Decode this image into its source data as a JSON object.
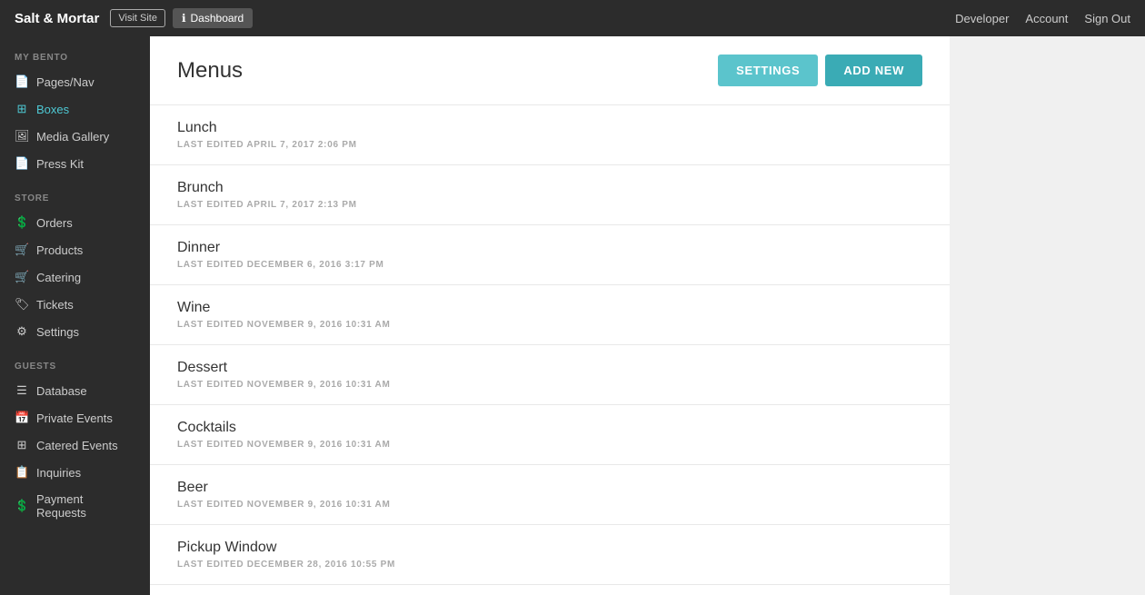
{
  "brand": "Salt & Mortar",
  "topnav": {
    "visit_site": "Visit Site",
    "dashboard": "Dashboard",
    "right_links": [
      "Developer",
      "Account",
      "Sign Out"
    ]
  },
  "sidebar": {
    "sections": [
      {
        "label": "MY BENTO",
        "items": [
          {
            "id": "pages-nav",
            "icon": "📄",
            "label": "Pages/Nav",
            "active": false
          },
          {
            "id": "boxes",
            "icon": "⊞",
            "label": "Boxes",
            "active": true
          },
          {
            "id": "media-gallery",
            "icon": "🖼",
            "label": "Media Gallery",
            "active": false
          },
          {
            "id": "press-kit",
            "icon": "📄",
            "label": "Press Kit",
            "active": false
          }
        ]
      },
      {
        "label": "STORE",
        "items": [
          {
            "id": "orders",
            "icon": "$",
            "label": "Orders",
            "active": false
          },
          {
            "id": "products",
            "icon": "🛒",
            "label": "Products",
            "active": false
          },
          {
            "id": "catering",
            "icon": "🛒",
            "label": "Catering",
            "active": false
          },
          {
            "id": "tickets",
            "icon": "🏷",
            "label": "Tickets",
            "active": false
          },
          {
            "id": "settings",
            "icon": "⚙",
            "label": "Settings",
            "active": false
          }
        ]
      },
      {
        "label": "GUESTS",
        "items": [
          {
            "id": "database",
            "icon": "☰",
            "label": "Database",
            "active": false
          },
          {
            "id": "private-events",
            "icon": "📅",
            "label": "Private Events",
            "active": false
          },
          {
            "id": "catered-events",
            "icon": "⊞",
            "label": "Catered Events",
            "active": false
          },
          {
            "id": "inquiries",
            "icon": "📋",
            "label": "Inquiries",
            "active": false
          },
          {
            "id": "payment-requests",
            "icon": "$",
            "label": "Payment Requests",
            "active": false
          }
        ]
      }
    ]
  },
  "content": {
    "title": "Menus",
    "settings_btn": "SETTINGS",
    "add_new_btn": "ADD NEW",
    "menus": [
      {
        "name": "Lunch",
        "last_edited": "LAST EDITED APRIL 7, 2017 2:06 PM"
      },
      {
        "name": "Brunch",
        "last_edited": "LAST EDITED APRIL 7, 2017 2:13 PM"
      },
      {
        "name": "Dinner",
        "last_edited": "LAST EDITED DECEMBER 6, 2016 3:17 PM"
      },
      {
        "name": "Wine",
        "last_edited": "LAST EDITED NOVEMBER 9, 2016 10:31 AM"
      },
      {
        "name": "Dessert",
        "last_edited": "LAST EDITED NOVEMBER 9, 2016 10:31 AM"
      },
      {
        "name": "Cocktails",
        "last_edited": "LAST EDITED NOVEMBER 9, 2016 10:31 AM"
      },
      {
        "name": "Beer",
        "last_edited": "LAST EDITED NOVEMBER 9, 2016 10:31 AM"
      },
      {
        "name": "Pickup Window",
        "last_edited": "LAST EDITED DECEMBER 28, 2016 10:55 PM"
      }
    ]
  }
}
